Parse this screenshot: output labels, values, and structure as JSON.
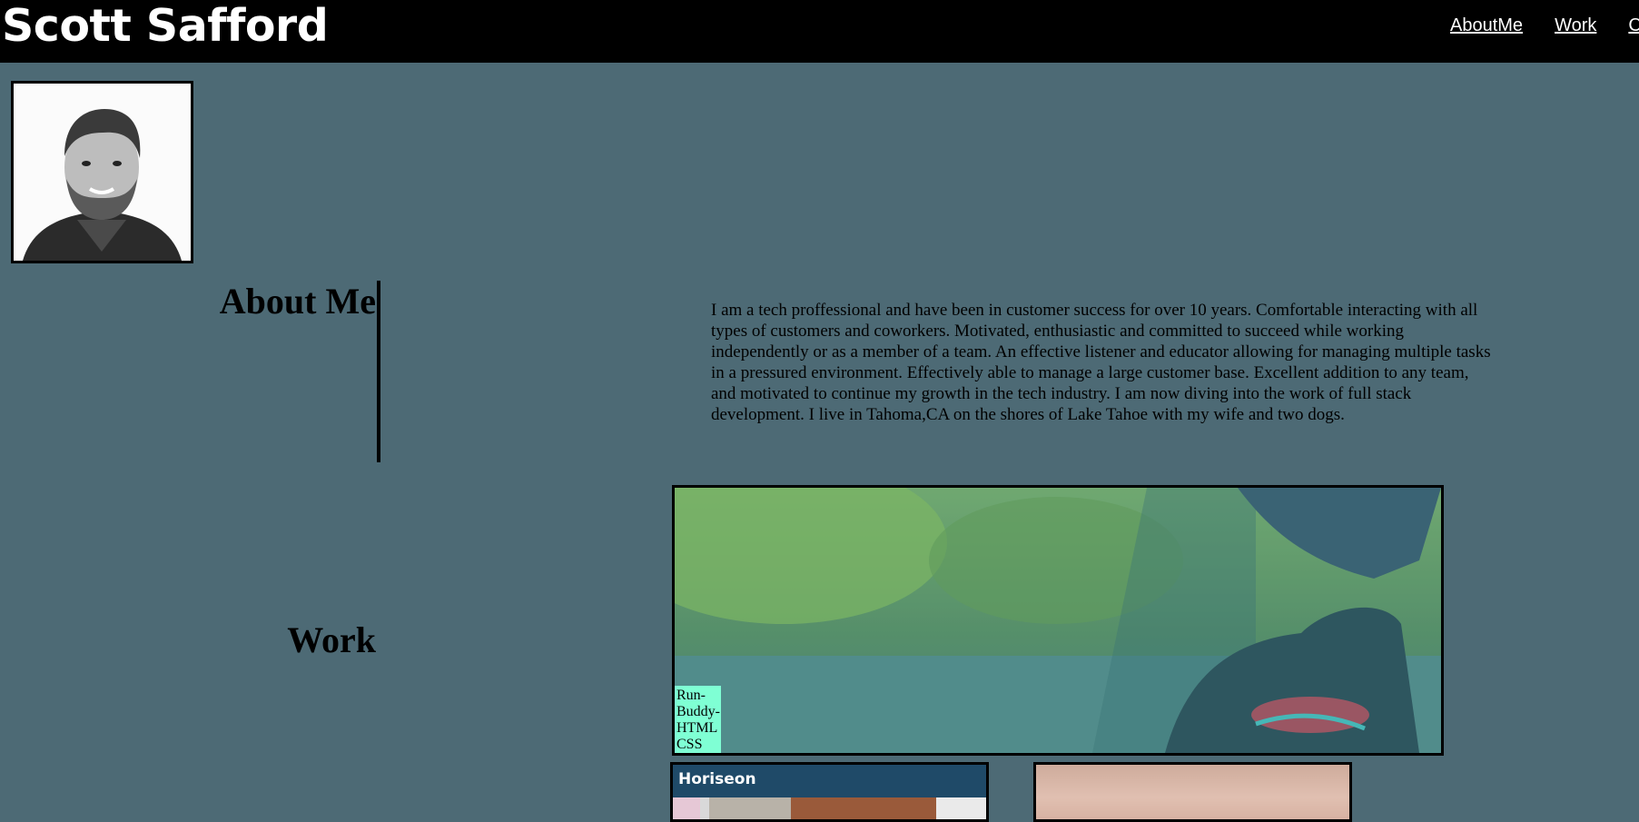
{
  "header": {
    "title": "Scott Safford",
    "nav": [
      "AboutMe",
      "Work",
      "Contact"
    ]
  },
  "profile": {
    "photo": "portrait-photo"
  },
  "about": {
    "heading": "About Me",
    "text": "I am a tech proffessional and have been in customer success for over 10 years. Comfortable interacting with all types of customers and coworkers. Motivated, enthusiastic and committed to succeed while working independently or as a member of a team. An effective listener and educator allowing for managing multiple tasks in a pressured environment. Effectively able to manage a large customer base. Excellent addition to any team, and motivated to continue my growth in the tech industry. I am now diving into the work of full stack development. I live in Tahoma,CA on the shores of Lake Tahoe with my wife and two dogs."
  },
  "work": {
    "heading": "Work",
    "projects": [
      {
        "label": "Run-Buddy-HTML CSS"
      },
      {
        "label": "Horiseon"
      }
    ]
  },
  "colors": {
    "header_bg": "#000000",
    "page_bg": "#4d6a75",
    "label_bg": "#7fffd4"
  }
}
